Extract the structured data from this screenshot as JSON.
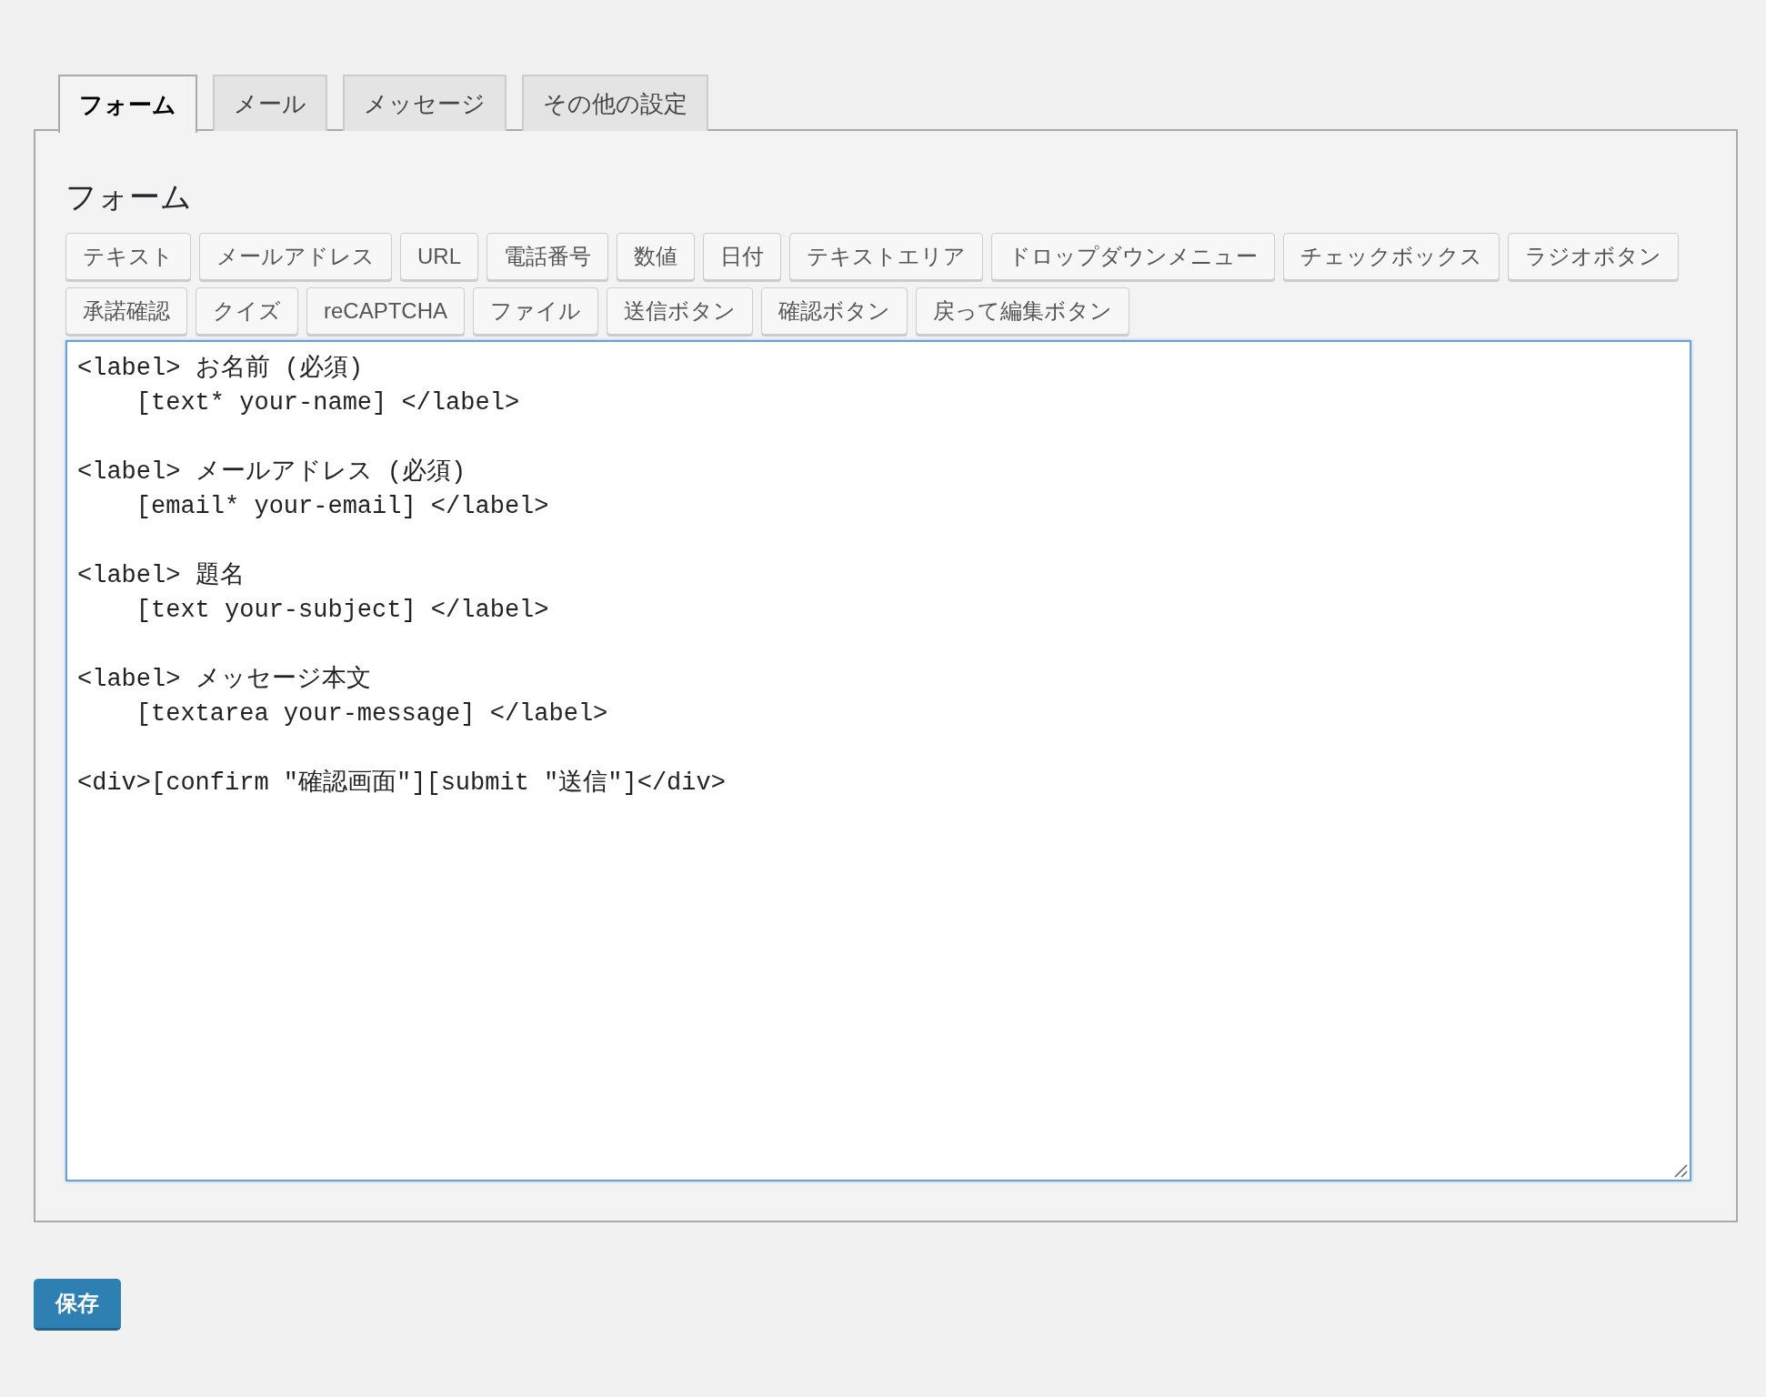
{
  "tabs": [
    {
      "label": "フォーム",
      "selected": true
    },
    {
      "label": "メール",
      "selected": false
    },
    {
      "label": "メッセージ",
      "selected": false
    },
    {
      "label": "その他の設定",
      "selected": false
    }
  ],
  "panel": {
    "heading": "フォーム",
    "tag_button_rows": [
      [
        "テキスト",
        "メールアドレス",
        "URL",
        "電話番号",
        "数値",
        "日付",
        "テキストエリア",
        "ドロップダウンメニュー",
        "チェックボックス",
        "ラジオボタン"
      ],
      [
        "承諾確認",
        "クイズ",
        "reCAPTCHA",
        "ファイル",
        "送信ボタン",
        "確認ボタン",
        "戻って編集ボタン"
      ]
    ],
    "editor_blocks": [
      [
        "<label> お名前 (必須)",
        "    [text* your-name] </label>"
      ],
      [
        "<label> メールアドレス (必須)",
        "    [email* your-email] </label>"
      ],
      [
        "<label> 題名",
        "    [text your-subject] </label>"
      ],
      [
        "<label> メッセージ本文",
        "    [textarea your-message] </label>"
      ],
      [
        "<div>[confirm \"確認画面\"][submit \"送信\"]</div>"
      ]
    ]
  },
  "save_button": "保存"
}
